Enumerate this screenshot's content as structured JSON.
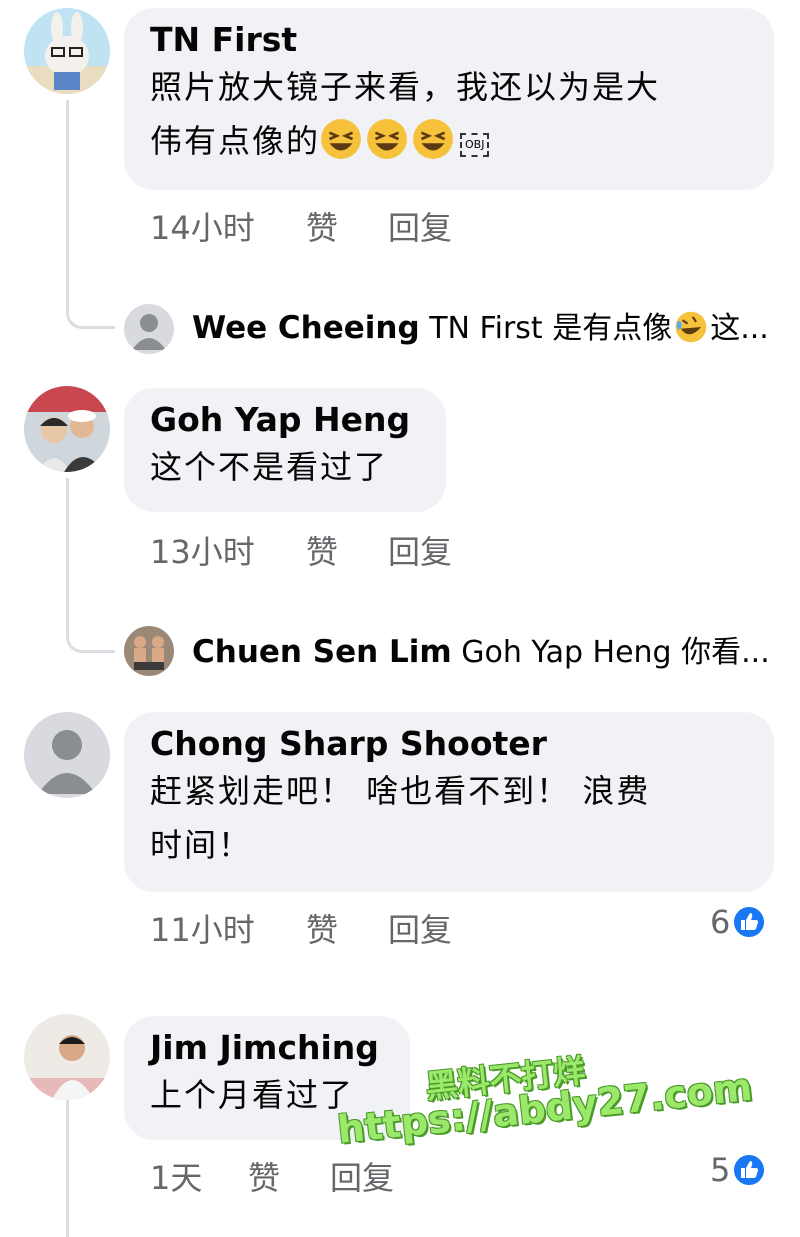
{
  "comments": [
    {
      "author": "TN First",
      "text_line1": "照片放大镜子来看，我还以为是大",
      "text_line2": "伟有点像的",
      "obj_tag": "OBJ",
      "time": "14小时",
      "like_label": "赞",
      "reply_label": "回复",
      "reply_preview": {
        "author": "Wee Cheeing",
        "snippet": "TN First 是有点像",
        "snippet_end": "这..."
      }
    },
    {
      "author": "Goh Yap Heng",
      "text_line1": "这个不是看过了",
      "time": "13小时",
      "like_label": "赞",
      "reply_label": "回复",
      "reply_preview": {
        "author": "Chuen Sen Lim",
        "snippet": "Goh Yap Heng 你看..."
      }
    },
    {
      "author": "Chong Sharp Shooter",
      "text_line1": "赶紧划走吧！ 啥也看不到！ 浪费",
      "text_line2": "时间！",
      "time": "11小时",
      "like_label": "赞",
      "reply_label": "回复",
      "reaction_count": "6"
    },
    {
      "author": "Jim Jimching",
      "text_line1": "上个月看过了",
      "time": "1天",
      "like_label": "赞",
      "reply_label": "回复",
      "reaction_count": "5"
    }
  ],
  "watermark": {
    "line1": "黑料不打烊",
    "line2": "https://abdy27.com"
  },
  "colors": {
    "bubble": "#f0f2f5",
    "meta": "#65676b",
    "like_blue": "#1877f2",
    "thread_line": "#dadde1"
  }
}
